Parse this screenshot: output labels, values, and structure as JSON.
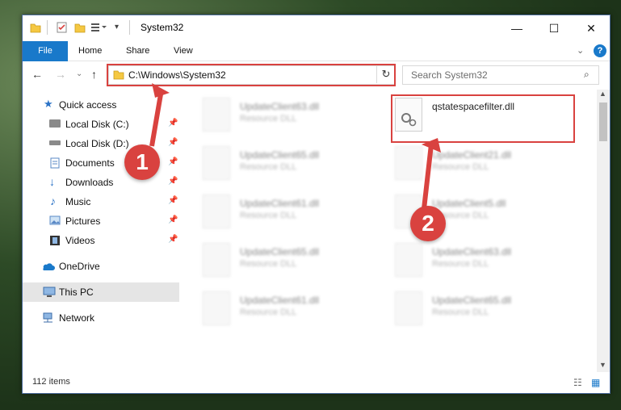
{
  "window": {
    "title": "System32",
    "colors": {
      "accent": "#1979ca",
      "highlight": "#d9423f"
    }
  },
  "ribbon": {
    "tabs": [
      "File",
      "Home",
      "Share",
      "View"
    ],
    "help_icon": "?"
  },
  "address": {
    "path": "C:\\Windows\\System32",
    "search_placeholder": "Search System32"
  },
  "sidebar": {
    "quick_access": "Quick access",
    "items": [
      {
        "label": "Local Disk (C:)",
        "icon": "drive-icon",
        "pinned": true
      },
      {
        "label": "Local Disk (D:)",
        "icon": "drive-icon",
        "pinned": true
      },
      {
        "label": "Documents",
        "icon": "documents-icon",
        "pinned": true
      },
      {
        "label": "Downloads",
        "icon": "download-icon",
        "pinned": true
      },
      {
        "label": "Music",
        "icon": "music-icon",
        "pinned": true
      },
      {
        "label": "Pictures",
        "icon": "pictures-icon",
        "pinned": true
      },
      {
        "label": "Videos",
        "icon": "videos-icon",
        "pinned": true
      }
    ],
    "onedrive": "OneDrive",
    "this_pc": "This PC",
    "network": "Network"
  },
  "files": {
    "highlighted": {
      "name": "qstatespacefilter.dll"
    },
    "left_column": [
      {
        "name": "UpdateClient63.dll",
        "type": "Resource DLL"
      },
      {
        "name": "UpdateClient65.dll",
        "type": "Resource DLL"
      },
      {
        "name": "UpdateClient61.dll",
        "type": "Resource DLL"
      },
      {
        "name": "UpdateClient65.dll",
        "type": "Resource DLL"
      },
      {
        "name": "UpdateClient61.dll",
        "type": "Resource DLL"
      }
    ],
    "right_column": [
      {
        "name": "UpdateClient21.dll",
        "type": "Resource DLL"
      },
      {
        "name": "UpdateClient5.dll",
        "type": "Resource DLL"
      },
      {
        "name": "UpdateClient63.dll",
        "type": "Resource DLL"
      },
      {
        "name": "UpdateClient65.dll",
        "type": "Resource DLL"
      }
    ]
  },
  "status": {
    "item_count": "112 items"
  },
  "callouts": [
    "1",
    "2"
  ]
}
